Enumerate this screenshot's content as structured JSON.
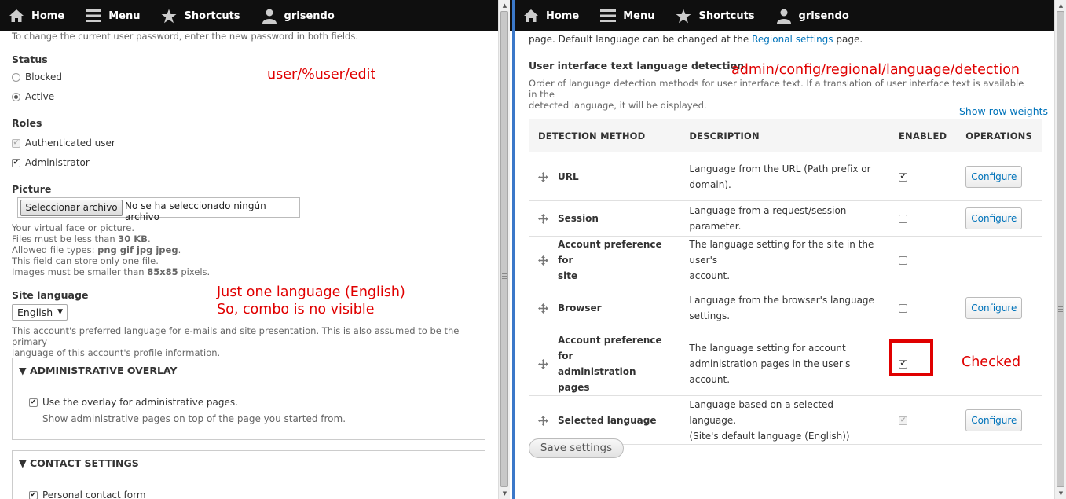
{
  "toolbar": {
    "home": "Home",
    "menu": "Menu",
    "shortcuts": "Shortcuts",
    "user": "grisendo"
  },
  "left": {
    "password_help": "To change the current user password, enter the new password in both fields.",
    "status": {
      "label": "Status",
      "options": [
        "Blocked",
        "Active"
      ],
      "selected": "Active"
    },
    "roles": {
      "label": "Roles",
      "items": [
        {
          "label": "Authenticated user",
          "checked": true,
          "disabled": true
        },
        {
          "label": "Administrator",
          "checked": true,
          "disabled": false
        }
      ]
    },
    "picture": {
      "label": "Picture",
      "button": "Seleccionar archivo",
      "no_file": "No se ha seleccionado ningún archivo",
      "help": {
        "line1": "Your virtual face or picture.",
        "line2_a": "Files must be less than ",
        "line2_b": "30 KB",
        "line2_c": ".",
        "line3_a": "Allowed file types: ",
        "line3_b": "png gif jpg jpeg",
        "line3_c": ".",
        "line4": "This field can store only one file.",
        "line5_a": "Images must be smaller than ",
        "line5_b": "85x85",
        "line5_c": " pixels."
      }
    },
    "site_language": {
      "label": "Site language",
      "value": "English",
      "help_line1": "This account's preferred language for e-mails and site presentation. This is also assumed to be the primary",
      "help_line2": "language of this account's profile information."
    },
    "admin_overlay": {
      "title": "ADMINISTRATIVE OVERLAY",
      "checkbox": "Use the overlay for administrative pages.",
      "checked": true,
      "help": "Show administrative pages on top of the page you started from."
    },
    "contact_settings": {
      "title": "CONTACT SETTINGS",
      "checkbox": "Personal contact form",
      "checked": true
    },
    "annotations": {
      "url": "user/%user/edit",
      "one_language_1": "Just one language (English)",
      "one_language_2": "So, combo is no visible"
    }
  },
  "right": {
    "intro_text": "page. Default language can be changed at the ",
    "intro_link": "Regional settings",
    "intro_end": " page.",
    "section_title": "User interface text language detection",
    "section_desc_1": "Order of language detection methods for user interface text. If a translation of user interface text is available in the",
    "section_desc_2": "detected language, it will be displayed.",
    "show_row_weights": "Show row weights",
    "columns": [
      "DETECTION METHOD",
      "DESCRIPTION",
      "ENABLED",
      "OPERATIONS"
    ],
    "rows": [
      {
        "method_1": "URL",
        "method_2": "",
        "desc_1": "Language from the URL (Path prefix or",
        "desc_2": "domain).",
        "enabled": true,
        "disabled": false,
        "op": "Configure"
      },
      {
        "method_1": "Session",
        "method_2": "",
        "desc_1": "Language from a request/session parameter.",
        "desc_2": "",
        "enabled": false,
        "disabled": false,
        "op": "Configure"
      },
      {
        "method_1": "Account preference for",
        "method_2": "site",
        "desc_1": "The language setting for the site in the user's",
        "desc_2": "account.",
        "enabled": false,
        "disabled": false,
        "op": ""
      },
      {
        "method_1": "Browser",
        "method_2": "",
        "desc_1": "Language from the browser's language",
        "desc_2": "settings.",
        "enabled": false,
        "disabled": false,
        "op": "Configure"
      },
      {
        "method_1": "Account preference for",
        "method_2": "administration pages",
        "desc_1": "The language setting for account",
        "desc_2": "administration pages in the user's account.",
        "enabled": true,
        "disabled": false,
        "op": ""
      },
      {
        "method_1": "Selected language",
        "method_2": "",
        "desc_1": "Language based on a selected language.",
        "desc_2": "(Site's default language (English))",
        "enabled": true,
        "disabled": true,
        "op": "Configure"
      }
    ],
    "save_button": "Save settings",
    "annotations": {
      "url": "admin/config/regional/language/detection",
      "checked": "Checked"
    }
  },
  "colors": {
    "toolbar_bg": "#0f0f0f",
    "link": "#0073ba",
    "annotation_red": "#e00000",
    "divider_blue": "#3b78c9"
  }
}
